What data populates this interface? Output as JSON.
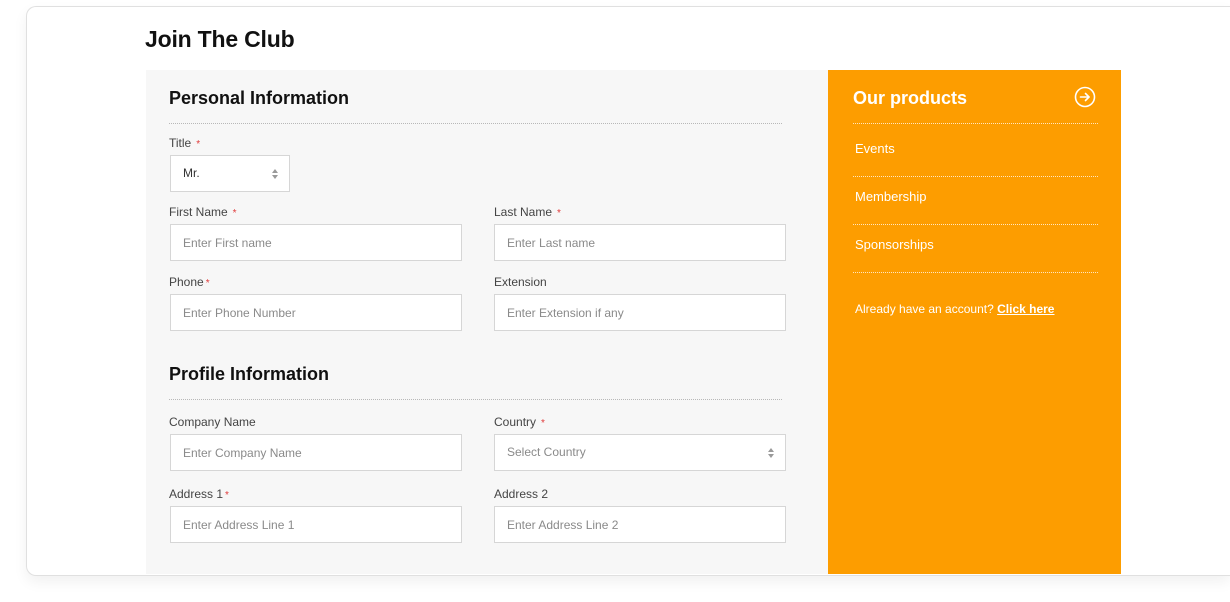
{
  "page": {
    "title": "Join The Club"
  },
  "personal_info": {
    "heading": "Personal Information",
    "title_field": {
      "label": "Title",
      "required": "*",
      "value": "Mr."
    },
    "first_name": {
      "label": "First Name",
      "required": "*",
      "placeholder": "Enter First name"
    },
    "last_name": {
      "label": "Last Name",
      "required": "*",
      "placeholder": "Enter Last name"
    },
    "phone": {
      "label": "Phone",
      "required": "*",
      "placeholder": "Enter Phone Number"
    },
    "extension": {
      "label": "Extension",
      "placeholder": "Enter Extension if any"
    }
  },
  "profile_info": {
    "heading": "Profile Information",
    "company_name": {
      "label": "Company Name",
      "placeholder": "Enter Company Name"
    },
    "country": {
      "label": "Country",
      "required": "*",
      "placeholder": "Select Country"
    },
    "address1": {
      "label": "Address 1",
      "required": "*",
      "placeholder": "Enter Address Line 1"
    },
    "address2": {
      "label": "Address 2",
      "placeholder": "Enter Address Line 2"
    }
  },
  "sidebar": {
    "title": "Our products",
    "arrow_icon": "arrow-right-circle-icon",
    "items": [
      {
        "label": "Events"
      },
      {
        "label": "Membership"
      },
      {
        "label": "Sponsorships"
      }
    ],
    "account_prompt": "Already have an account?",
    "account_link": "Click here"
  },
  "colors": {
    "accent": "#fd9d00",
    "required": "#e03a3a",
    "form_background": "#f7f7f7"
  }
}
